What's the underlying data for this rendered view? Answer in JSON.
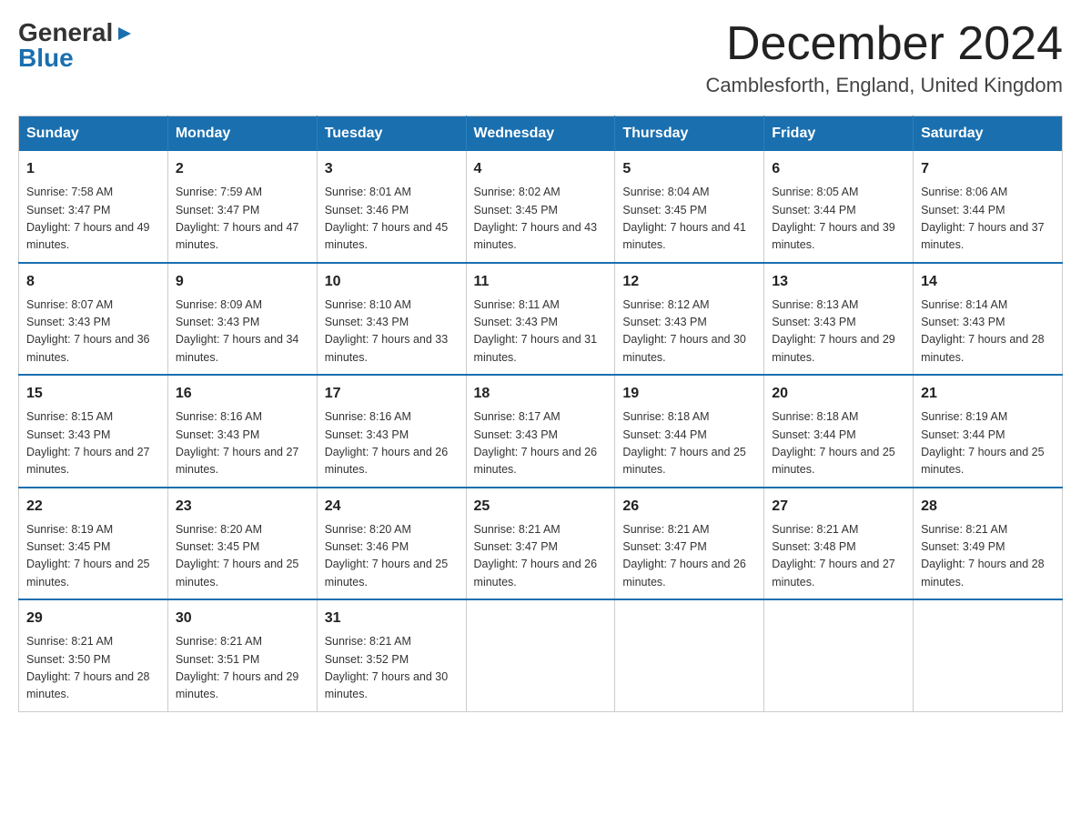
{
  "header": {
    "logo": {
      "general": "General",
      "blue": "Blue",
      "arrow_color": "#1a6faf"
    },
    "month_title": "December 2024",
    "location": "Camblesforth, England, United Kingdom"
  },
  "days_of_week": [
    "Sunday",
    "Monday",
    "Tuesday",
    "Wednesday",
    "Thursday",
    "Friday",
    "Saturday"
  ],
  "weeks": [
    [
      {
        "day": "1",
        "sunrise": "7:58 AM",
        "sunset": "3:47 PM",
        "daylight": "7 hours and 49 minutes."
      },
      {
        "day": "2",
        "sunrise": "7:59 AM",
        "sunset": "3:47 PM",
        "daylight": "7 hours and 47 minutes."
      },
      {
        "day": "3",
        "sunrise": "8:01 AM",
        "sunset": "3:46 PM",
        "daylight": "7 hours and 45 minutes."
      },
      {
        "day": "4",
        "sunrise": "8:02 AM",
        "sunset": "3:45 PM",
        "daylight": "7 hours and 43 minutes."
      },
      {
        "day": "5",
        "sunrise": "8:04 AM",
        "sunset": "3:45 PM",
        "daylight": "7 hours and 41 minutes."
      },
      {
        "day": "6",
        "sunrise": "8:05 AM",
        "sunset": "3:44 PM",
        "daylight": "7 hours and 39 minutes."
      },
      {
        "day": "7",
        "sunrise": "8:06 AM",
        "sunset": "3:44 PM",
        "daylight": "7 hours and 37 minutes."
      }
    ],
    [
      {
        "day": "8",
        "sunrise": "8:07 AM",
        "sunset": "3:43 PM",
        "daylight": "7 hours and 36 minutes."
      },
      {
        "day": "9",
        "sunrise": "8:09 AM",
        "sunset": "3:43 PM",
        "daylight": "7 hours and 34 minutes."
      },
      {
        "day": "10",
        "sunrise": "8:10 AM",
        "sunset": "3:43 PM",
        "daylight": "7 hours and 33 minutes."
      },
      {
        "day": "11",
        "sunrise": "8:11 AM",
        "sunset": "3:43 PM",
        "daylight": "7 hours and 31 minutes."
      },
      {
        "day": "12",
        "sunrise": "8:12 AM",
        "sunset": "3:43 PM",
        "daylight": "7 hours and 30 minutes."
      },
      {
        "day": "13",
        "sunrise": "8:13 AM",
        "sunset": "3:43 PM",
        "daylight": "7 hours and 29 minutes."
      },
      {
        "day": "14",
        "sunrise": "8:14 AM",
        "sunset": "3:43 PM",
        "daylight": "7 hours and 28 minutes."
      }
    ],
    [
      {
        "day": "15",
        "sunrise": "8:15 AM",
        "sunset": "3:43 PM",
        "daylight": "7 hours and 27 minutes."
      },
      {
        "day": "16",
        "sunrise": "8:16 AM",
        "sunset": "3:43 PM",
        "daylight": "7 hours and 27 minutes."
      },
      {
        "day": "17",
        "sunrise": "8:16 AM",
        "sunset": "3:43 PM",
        "daylight": "7 hours and 26 minutes."
      },
      {
        "day": "18",
        "sunrise": "8:17 AM",
        "sunset": "3:43 PM",
        "daylight": "7 hours and 26 minutes."
      },
      {
        "day": "19",
        "sunrise": "8:18 AM",
        "sunset": "3:44 PM",
        "daylight": "7 hours and 25 minutes."
      },
      {
        "day": "20",
        "sunrise": "8:18 AM",
        "sunset": "3:44 PM",
        "daylight": "7 hours and 25 minutes."
      },
      {
        "day": "21",
        "sunrise": "8:19 AM",
        "sunset": "3:44 PM",
        "daylight": "7 hours and 25 minutes."
      }
    ],
    [
      {
        "day": "22",
        "sunrise": "8:19 AM",
        "sunset": "3:45 PM",
        "daylight": "7 hours and 25 minutes."
      },
      {
        "day": "23",
        "sunrise": "8:20 AM",
        "sunset": "3:45 PM",
        "daylight": "7 hours and 25 minutes."
      },
      {
        "day": "24",
        "sunrise": "8:20 AM",
        "sunset": "3:46 PM",
        "daylight": "7 hours and 25 minutes."
      },
      {
        "day": "25",
        "sunrise": "8:21 AM",
        "sunset": "3:47 PM",
        "daylight": "7 hours and 26 minutes."
      },
      {
        "day": "26",
        "sunrise": "8:21 AM",
        "sunset": "3:47 PM",
        "daylight": "7 hours and 26 minutes."
      },
      {
        "day": "27",
        "sunrise": "8:21 AM",
        "sunset": "3:48 PM",
        "daylight": "7 hours and 27 minutes."
      },
      {
        "day": "28",
        "sunrise": "8:21 AM",
        "sunset": "3:49 PM",
        "daylight": "7 hours and 28 minutes."
      }
    ],
    [
      {
        "day": "29",
        "sunrise": "8:21 AM",
        "sunset": "3:50 PM",
        "daylight": "7 hours and 28 minutes."
      },
      {
        "day": "30",
        "sunrise": "8:21 AM",
        "sunset": "3:51 PM",
        "daylight": "7 hours and 29 minutes."
      },
      {
        "day": "31",
        "sunrise": "8:21 AM",
        "sunset": "3:52 PM",
        "daylight": "7 hours and 30 minutes."
      },
      null,
      null,
      null,
      null
    ]
  ]
}
